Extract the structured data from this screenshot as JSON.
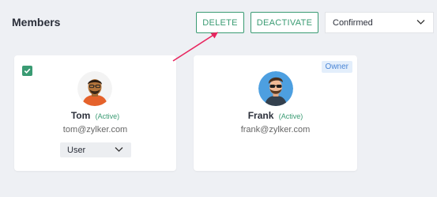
{
  "header": {
    "title": "Members",
    "delete_label": "DELETE",
    "deactivate_label": "DEACTIVATE",
    "filter": {
      "selected": "Confirmed"
    }
  },
  "members": [
    {
      "name": "Tom",
      "status": "(Active)",
      "email": "tom@zylker.com",
      "role": "User",
      "selected": true,
      "avatar": "man-orange-shirt-avatar"
    },
    {
      "name": "Frank",
      "status": "(Active)",
      "email": "frank@zylker.com",
      "badge": "Owner",
      "avatar": "man-sunglasses-avatar"
    }
  ],
  "colors": {
    "accent": "#3a9b73",
    "annotation_arrow": "#e8265f",
    "owner_badge_bg": "#e3eefb",
    "owner_badge_text": "#4b86d6"
  },
  "icons": [
    "check-icon",
    "chevron-down-icon",
    "annotation-arrow"
  ]
}
